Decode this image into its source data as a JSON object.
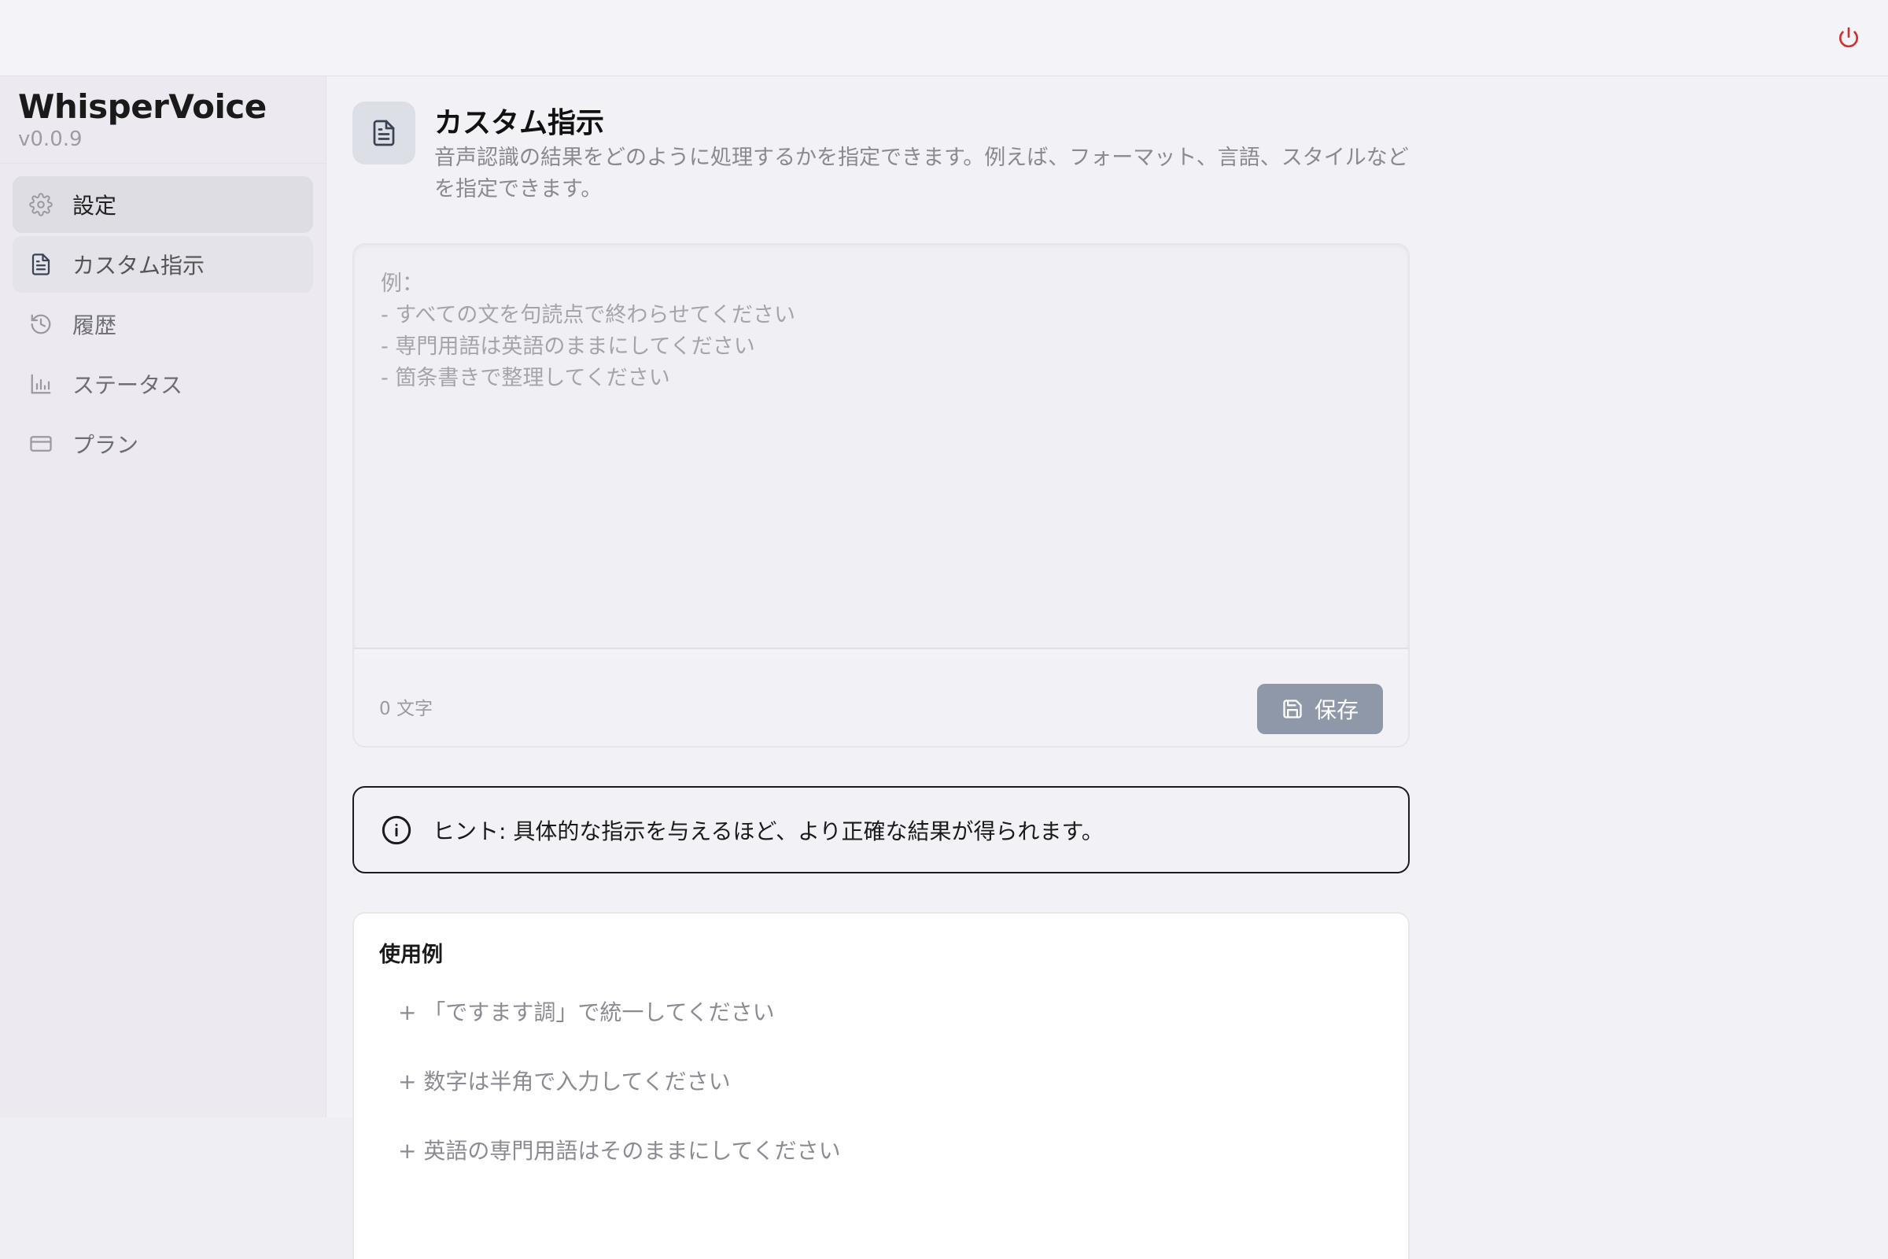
{
  "app": {
    "name": "WhisperVoice",
    "version": "v0.0.9"
  },
  "topbar": {
    "power_icon": "power-icon",
    "power_color": "#d32f2f"
  },
  "sidebar": {
    "items": [
      {
        "label": "設定",
        "icon": "gear-icon"
      },
      {
        "label": "カスタム指示",
        "icon": "document-icon"
      },
      {
        "label": "履歴",
        "icon": "history-icon"
      },
      {
        "label": "ステータス",
        "icon": "bar-chart-icon"
      },
      {
        "label": "プラン",
        "icon": "credit-card-icon"
      }
    ]
  },
  "main": {
    "title": "カスタム指示",
    "description": "音声認識の結果をどのように処理するかを指定できます。例えば、フォーマット、言語、スタイルなどを指定できます。",
    "editor": {
      "placeholder": "例：\n- すべての文を句読点で終わらせてください\n- 専門用語は英語のままにしてください\n- 箇条書きで整理してください",
      "char_count": "0 文字",
      "save_label": "保存"
    },
    "hint": {
      "text": "ヒント: 具体的な指示を与えるほど、より正確な結果が得られます。"
    },
    "examples": {
      "title": "使用例",
      "items": [
        "+ 「ですます調」で統一してください",
        "+ 数字は半角で入力してください",
        "+ 英語の専門用語はそのままにしてください"
      ]
    }
  }
}
